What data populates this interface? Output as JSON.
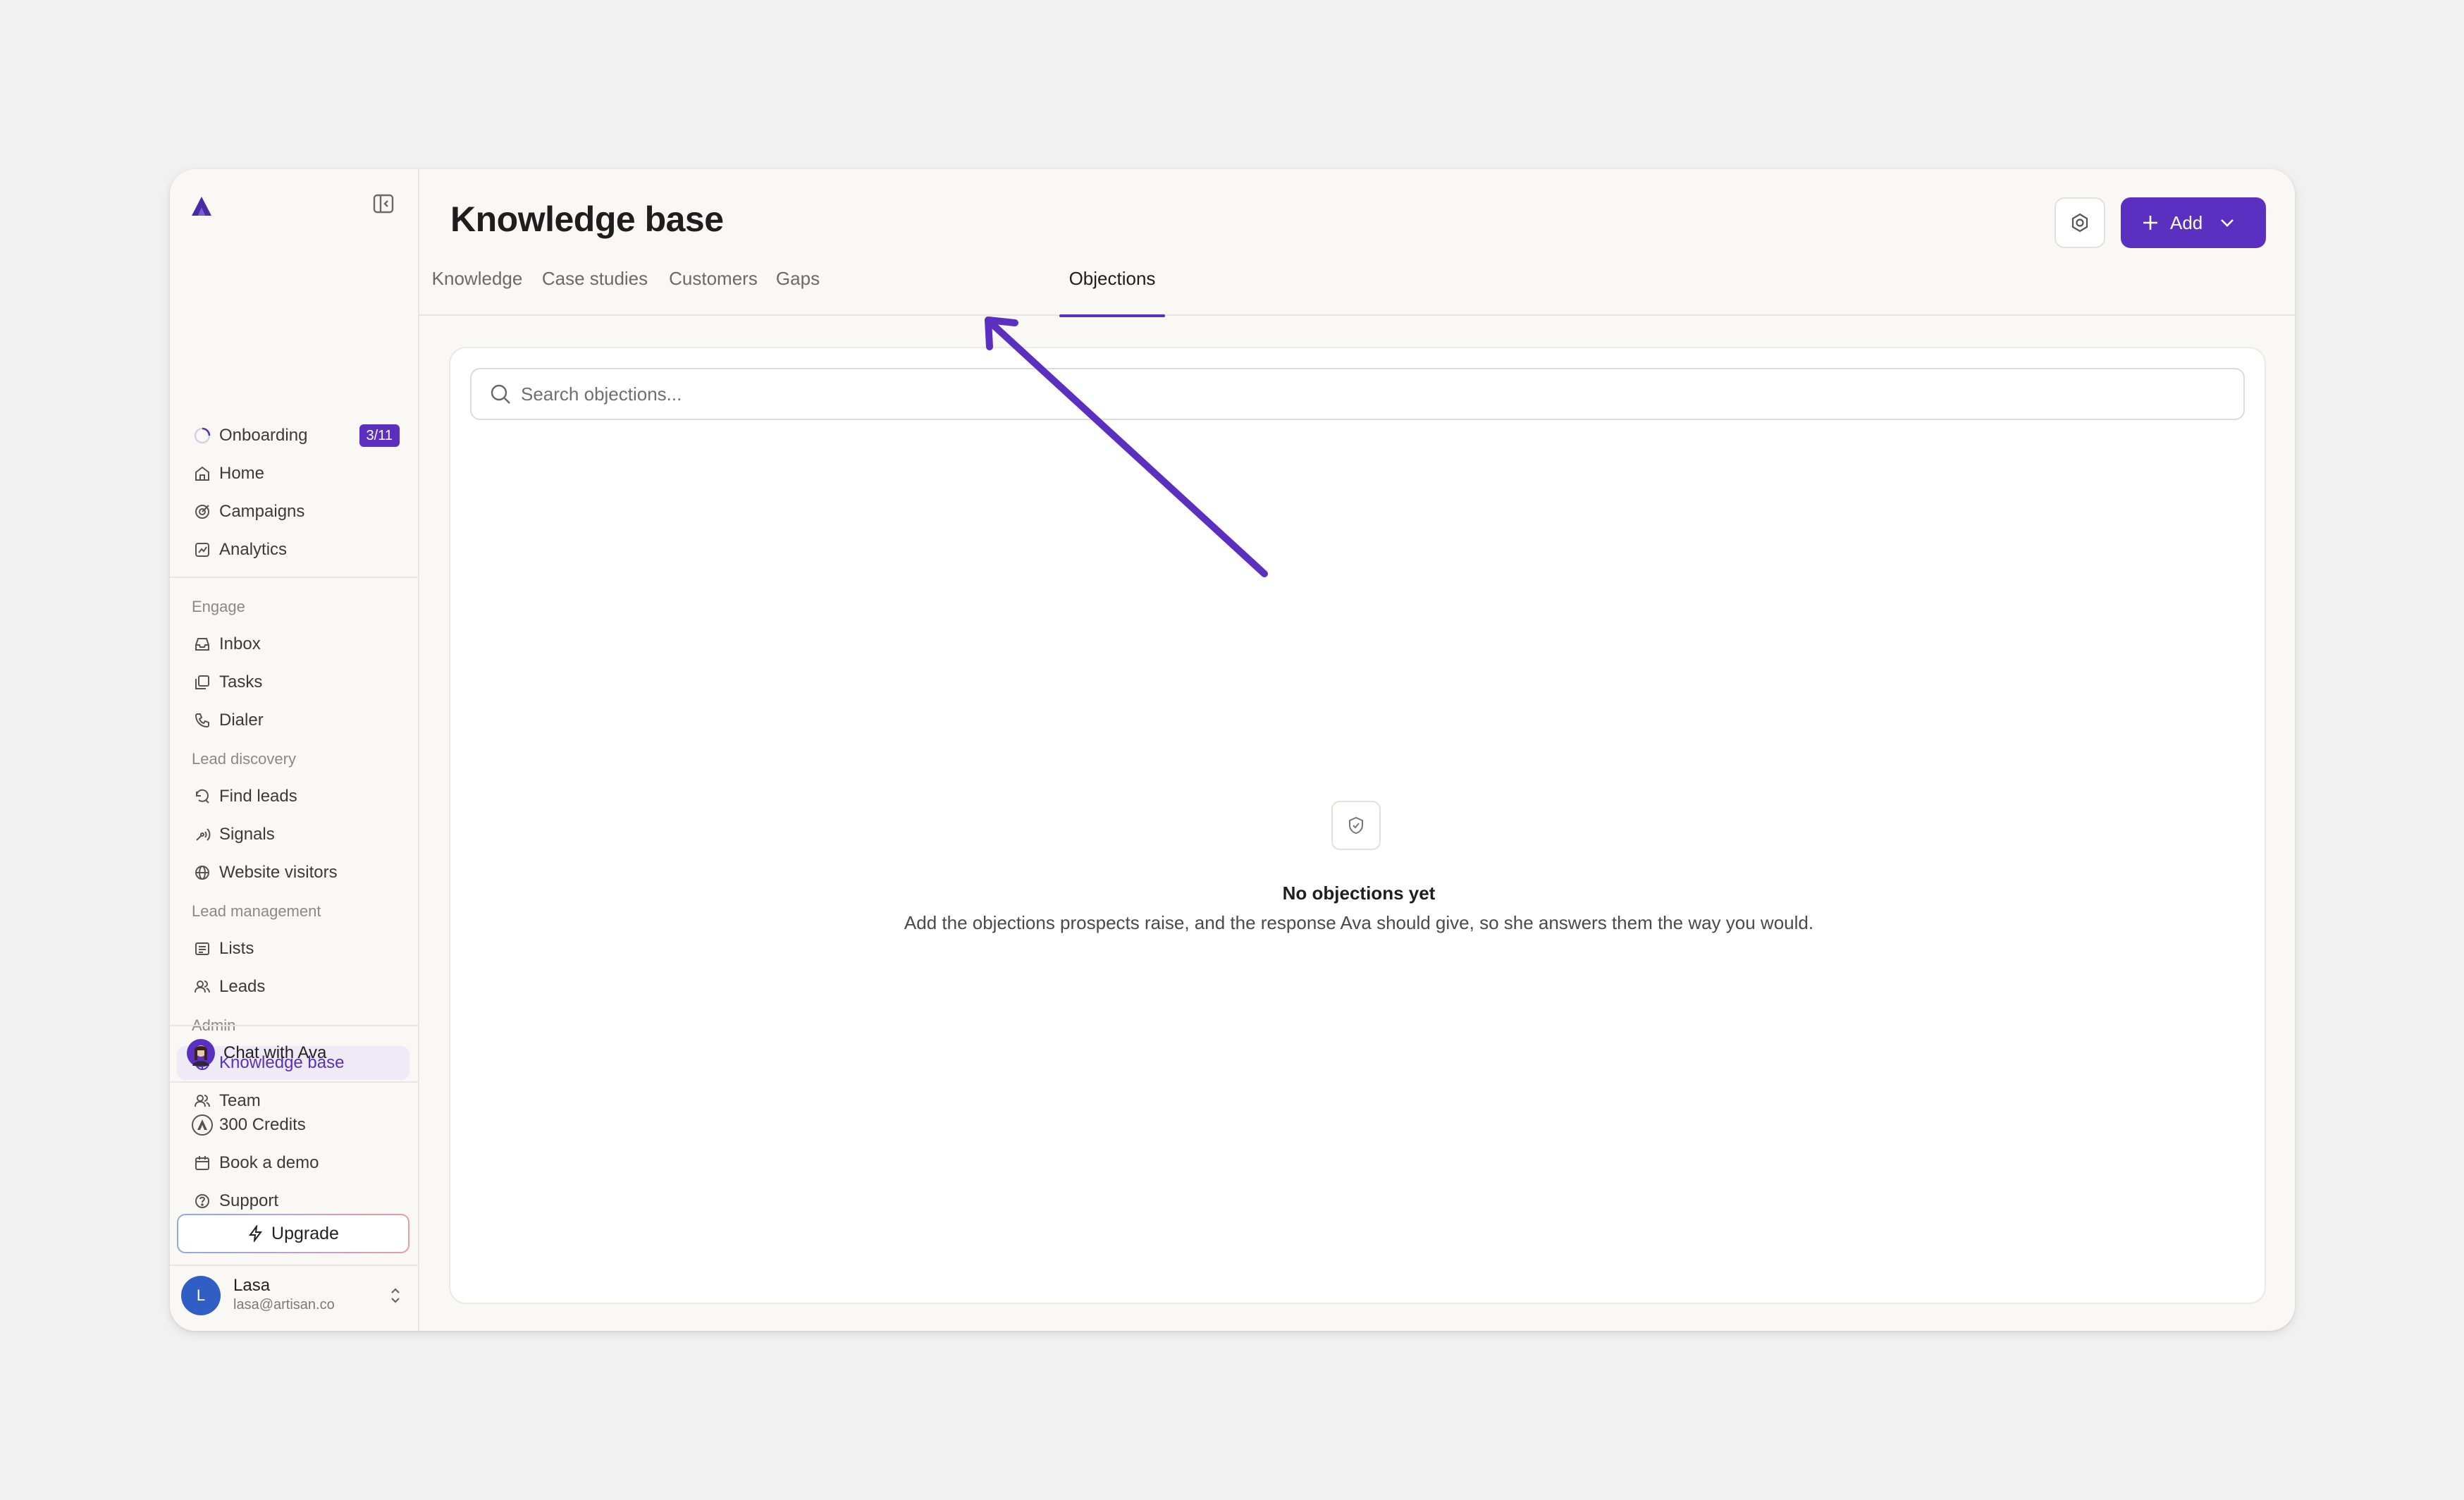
{
  "sidebar": {
    "onboarding": {
      "label": "Onboarding",
      "badge": "3/11"
    },
    "top_items": [
      {
        "label": "Home"
      },
      {
        "label": "Campaigns"
      },
      {
        "label": "Analytics"
      }
    ],
    "sections": {
      "engage": "Engage",
      "lead_discovery": "Lead discovery",
      "lead_management": "Lead management",
      "admin": "Admin"
    },
    "engage_items": [
      {
        "label": "Inbox"
      },
      {
        "label": "Tasks"
      },
      {
        "label": "Dialer"
      }
    ],
    "discovery_items": [
      {
        "label": "Find leads"
      },
      {
        "label": "Signals"
      },
      {
        "label": "Website visitors"
      }
    ],
    "management_items": [
      {
        "label": "Lists"
      },
      {
        "label": "Leads"
      }
    ],
    "admin_items": [
      {
        "label": "Knowledge base",
        "active": true
      },
      {
        "label": "Team"
      }
    ],
    "chat": {
      "label": "Chat with Ava"
    },
    "credits": {
      "label": "300 Credits"
    },
    "book_demo": {
      "label": "Book a demo"
    },
    "support": {
      "label": "Support"
    },
    "upgrade": {
      "label": "Upgrade"
    },
    "user": {
      "initial": "L",
      "name": "Lasa",
      "email": "lasa@artisan.co"
    }
  },
  "header": {
    "title": "Knowledge base",
    "add_label": "Add"
  },
  "tabs": [
    {
      "label": "Knowledge"
    },
    {
      "label": "Case studies"
    },
    {
      "label": "Customers"
    },
    {
      "label": "Gaps"
    },
    {
      "label": "Objections",
      "active": true
    }
  ],
  "search": {
    "placeholder": "Search objections..."
  },
  "empty_state": {
    "icon": "shield-check-icon",
    "title": "No objections yet",
    "description": "Add the objections prospects raise, and the response Ava should give, so she answers them the way you would."
  },
  "colors": {
    "accent": "#5b2fbf",
    "annotation_arrow": "#5b2fbf"
  }
}
